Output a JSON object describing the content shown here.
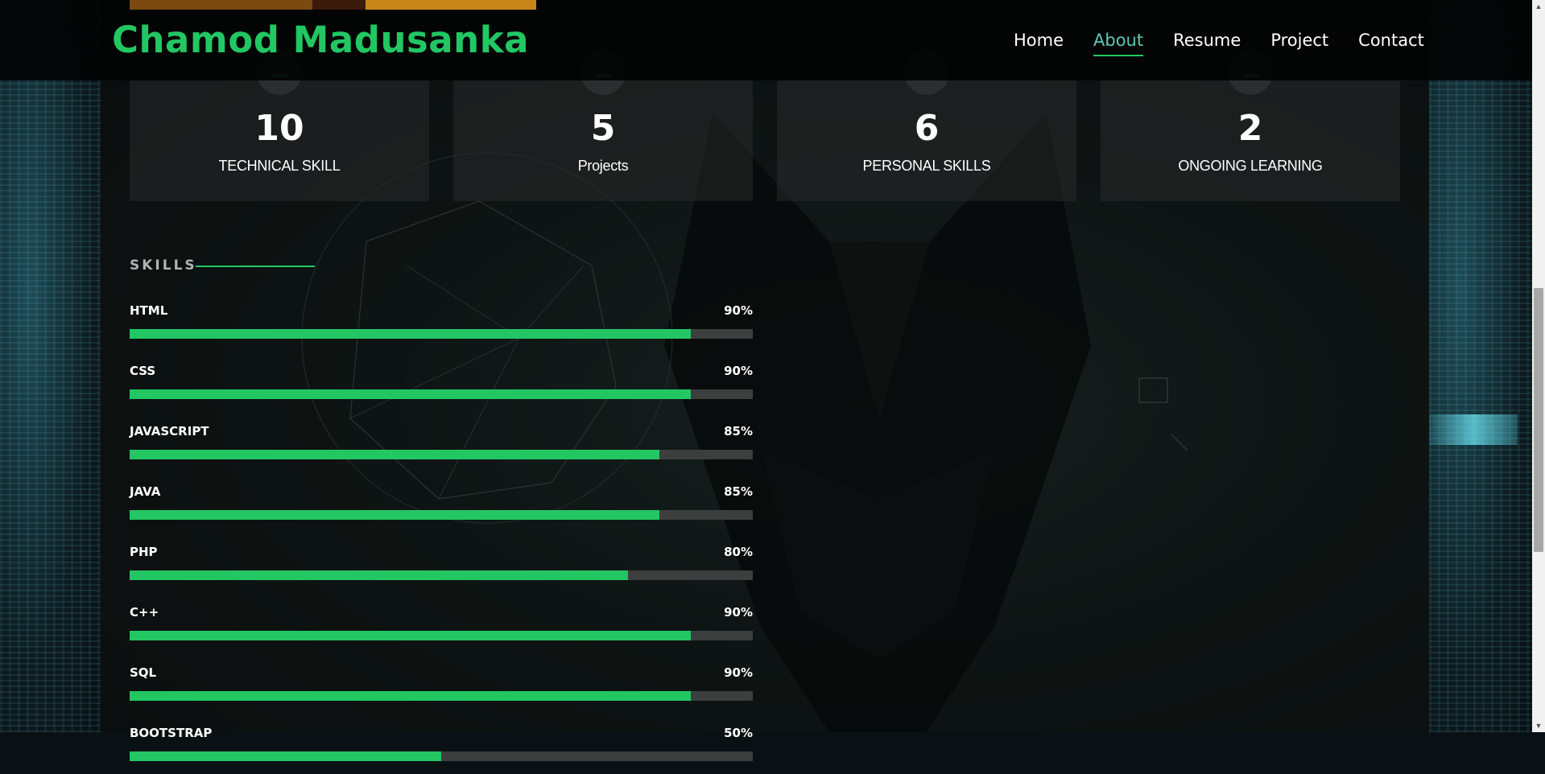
{
  "header": {
    "logo": "Chamod Madusanka",
    "nav": [
      "Home",
      "About",
      "Resume",
      "Project",
      "Contact"
    ],
    "active": "About"
  },
  "stats": [
    {
      "number": "10",
      "label": "TECHNICAL SKILL"
    },
    {
      "number": "5",
      "label": "Projects"
    },
    {
      "number": "6",
      "label": "PERSONAL SKILLS"
    },
    {
      "number": "2",
      "label": "ONGOING LEARNING"
    }
  ],
  "skills": {
    "heading": "SKILLS",
    "items": [
      {
        "name": "HTML",
        "percent_text": "90%",
        "percent": 90
      },
      {
        "name": "CSS",
        "percent_text": "90%",
        "percent": 90
      },
      {
        "name": "JAVASCRIPT",
        "percent_text": "85%",
        "percent": 85
      },
      {
        "name": "JAVA",
        "percent_text": "85%",
        "percent": 85
      },
      {
        "name": "PHP",
        "percent_text": "80%",
        "percent": 80
      },
      {
        "name": "C++",
        "percent_text": "90%",
        "percent": 90
      },
      {
        "name": "SQL",
        "percent_text": "90%",
        "percent": 90
      },
      {
        "name": "BOOTSTRAP",
        "percent_text": "50%",
        "percent": 50
      }
    ]
  },
  "colors": {
    "accent": "#22c763",
    "active_nav": "#5cc9b5",
    "track": "#3d3f3f"
  }
}
